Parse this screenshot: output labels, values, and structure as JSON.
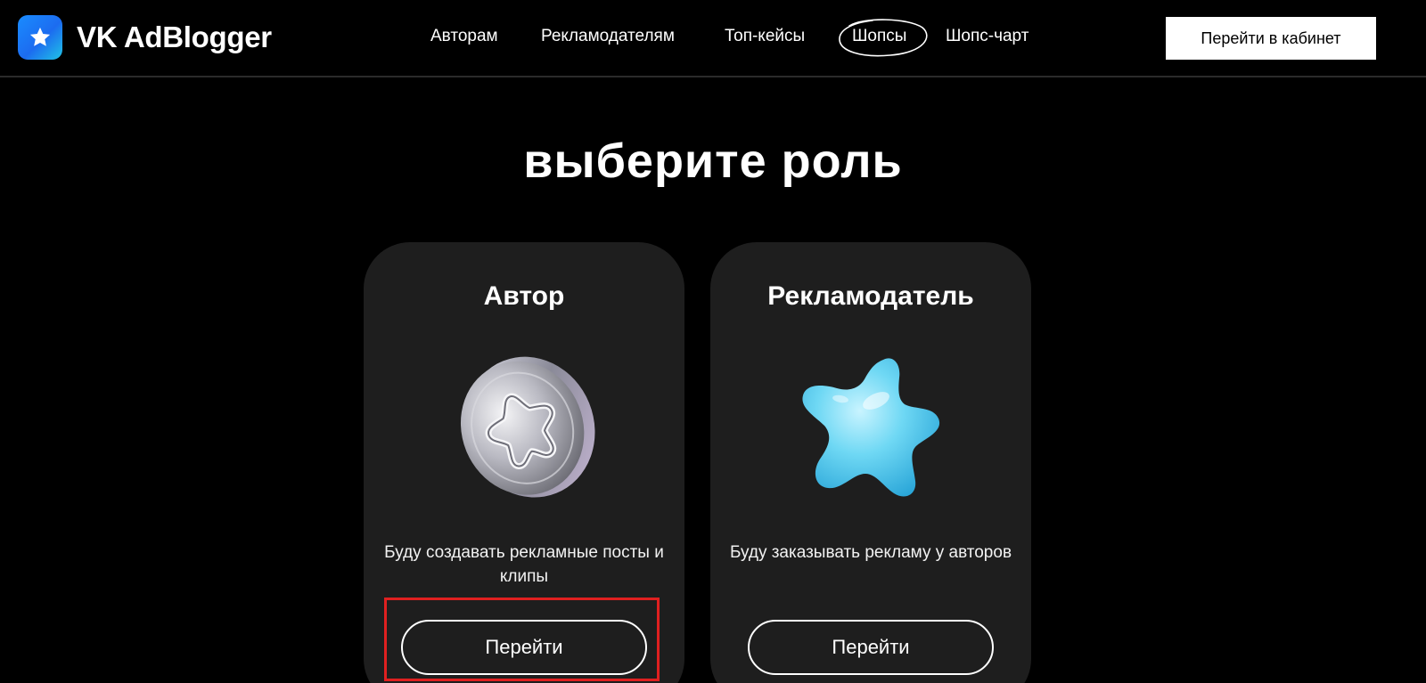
{
  "header": {
    "logo_text": "VK AdBlogger",
    "nav": [
      "Авторам",
      "Рекламодателям",
      "Топ-кейсы",
      "Шопсы",
      "Шопс-чарт"
    ],
    "cabinet_button": "Перейти в кабинет"
  },
  "main": {
    "title": "выберите роль",
    "cards": [
      {
        "title": "Автор",
        "description": "Буду создавать рекламные посты и клипы",
        "button": "Перейти",
        "icon": "silver-coin-star-icon"
      },
      {
        "title": "Рекламодатель",
        "description": "Буду заказывать рекламу у авторов",
        "button": "Перейти",
        "icon": "blue-star-icon"
      }
    ]
  },
  "colors": {
    "background": "#000000",
    "card": "#1e1e1e",
    "accent": "#1a8cff",
    "highlight": "#e02020"
  }
}
